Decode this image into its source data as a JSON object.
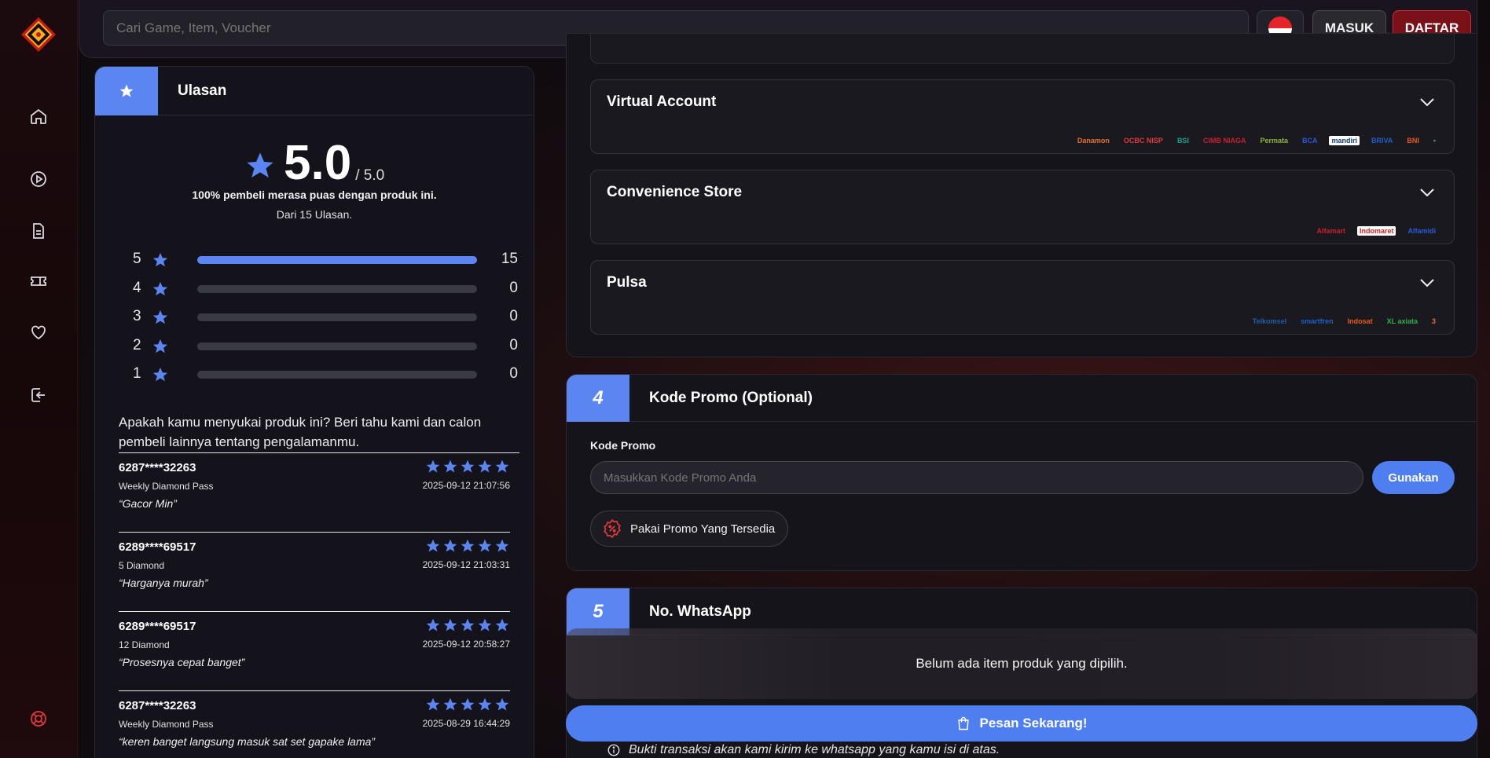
{
  "topbar": {
    "search_placeholder": "Cari Game, Item, Voucher",
    "login_label": "MASUK",
    "register_label": "DAFTAR",
    "language_flag": "indonesia-flag-icon"
  },
  "sidebar": {
    "items": [
      {
        "icon": "home-icon"
      },
      {
        "icon": "play-circle-icon"
      },
      {
        "icon": "document-icon"
      },
      {
        "icon": "ticket-icon"
      },
      {
        "icon": "heart-icon"
      },
      {
        "icon": "logout-icon"
      }
    ],
    "bottom_icon": "lifebuoy-icon"
  },
  "reviews": {
    "title": "Ulasan",
    "score": "5.0",
    "score_max": "/ 5.0",
    "satisfied_text": "100% pembeli merasa puas dengan produk ini.",
    "count_text": "Dari 15 Ulasan.",
    "breakdown": [
      {
        "stars": "5",
        "count": "15",
        "fraction": 1.0
      },
      {
        "stars": "4",
        "count": "0",
        "fraction": 0
      },
      {
        "stars": "3",
        "count": "0",
        "fraction": 0
      },
      {
        "stars": "2",
        "count": "0",
        "fraction": 0
      },
      {
        "stars": "1",
        "count": "0",
        "fraction": 0
      }
    ],
    "prompt": "Apakah kamu menyukai produk ini? Beri tahu kami dan calon pembeli lainnya tentang pengalamanmu.",
    "items": [
      {
        "user": "6287****32263",
        "product": "Weekly Diamond Pass",
        "date": "2025-09-12 21:07:56",
        "quote": "“Gacor Min”",
        "rating": 5
      },
      {
        "user": "6289****69517",
        "product": "5 Diamond",
        "date": "2025-09-12 21:03:31",
        "quote": "“Harganya murah”",
        "rating": 5
      },
      {
        "user": "6289****69517",
        "product": "12 Diamond",
        "date": "2025-09-12 20:58:27",
        "quote": "“Prosesnya cepat banget”",
        "rating": 5
      },
      {
        "user": "6287****32263",
        "product": "Weekly Diamond Pass",
        "date": "2025-08-29 16:44:29",
        "quote": "“keren banget langsung masuk sat set gapake lama”",
        "rating": 5
      }
    ]
  },
  "payment": {
    "methods": [
      {
        "name": "Virtual Account",
        "logos": [
          "Danamon",
          "OCBC NISP",
          "BSI",
          "CIMB NIAGA",
          "Permata",
          "BCA",
          "mandiri",
          "BRIVA",
          "BNI",
          "•"
        ]
      },
      {
        "name": "Convenience Store",
        "logos": [
          "Alfamart",
          "Indomaret",
          "Alfamidi"
        ]
      },
      {
        "name": "Pulsa",
        "logos": [
          "Telkomsel",
          "smartfren",
          "Indosat",
          "XL axiata",
          "3"
        ]
      }
    ]
  },
  "promo": {
    "step": "4",
    "title": "Kode Promo (Optional)",
    "label": "Kode Promo",
    "placeholder": "Masukkan Kode Promo Anda",
    "apply_label": "Gunakan",
    "available_label": "Pakai Promo Yang Tersedia"
  },
  "whatsapp": {
    "step": "5",
    "title": "No. WhatsApp"
  },
  "order": {
    "empty_message": "Belum ada item produk yang dipilih.",
    "order_label": "Pesan Sekarang!",
    "note": "Bukti transaksi akan kami kirim ke whatsapp yang kamu isi di atas."
  },
  "colors": {
    "accent": "#5b86f2",
    "register": "#7a1018",
    "star": "#5b86f2"
  }
}
